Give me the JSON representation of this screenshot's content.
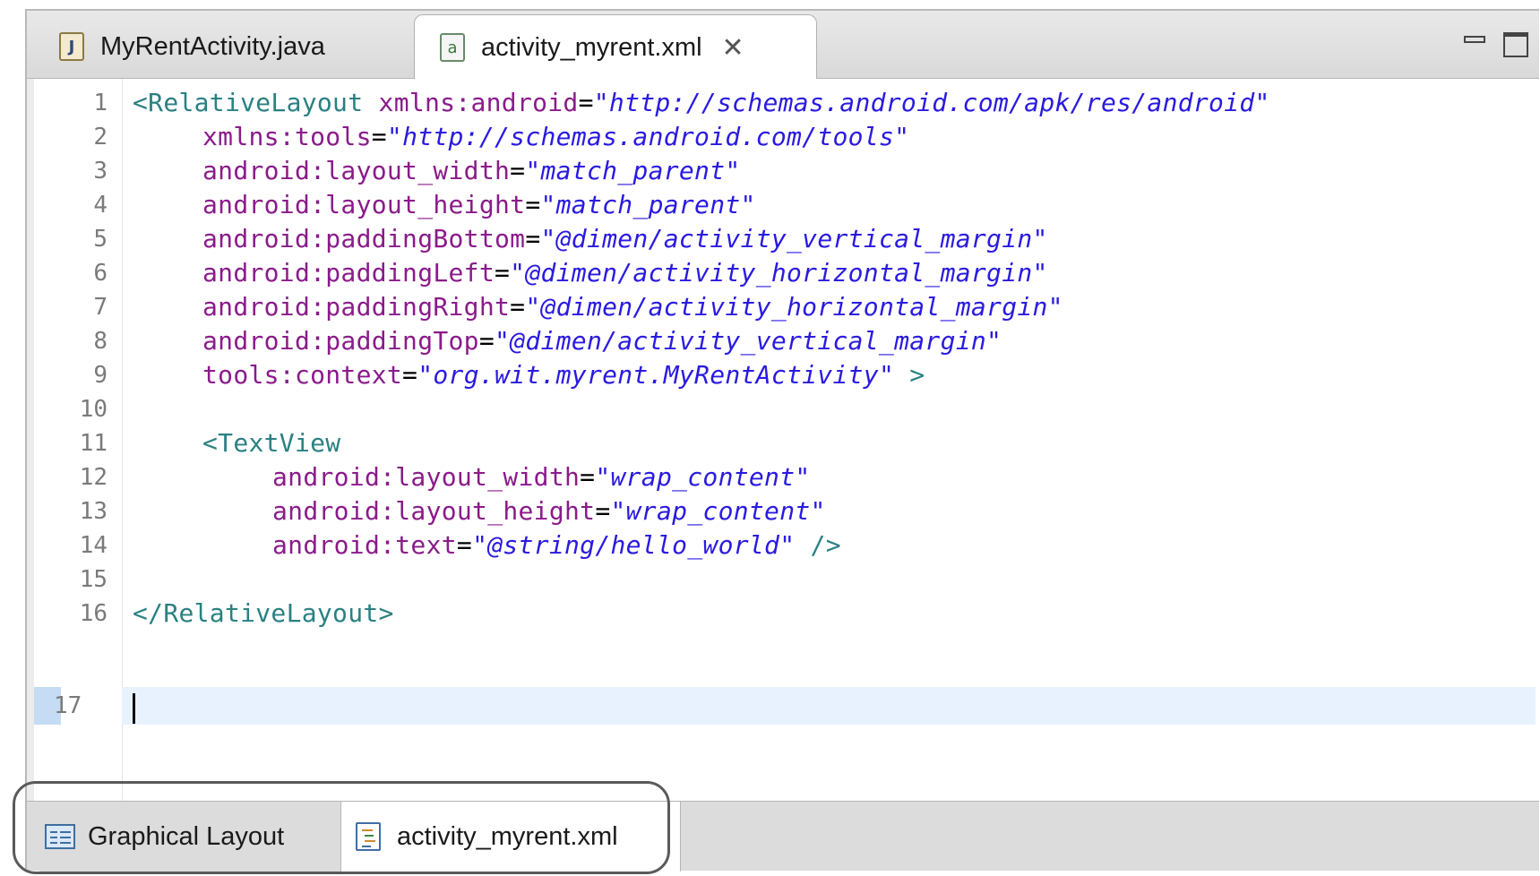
{
  "editor_tabs": [
    {
      "label": "MyRentActivity.java",
      "icon": "java-file-icon",
      "active": false
    },
    {
      "label": "activity_myrent.xml",
      "icon": "android-xml-file-icon",
      "active": true,
      "close_glyph": "✕"
    }
  ],
  "window_controls": {
    "minimize": "minimize-icon",
    "maximize": "maximize-icon"
  },
  "line_numbers": [
    "1",
    "2",
    "3",
    "4",
    "5",
    "6",
    "7",
    "8",
    "9",
    "10",
    "11",
    "12",
    "13",
    "14",
    "15",
    "16",
    "17"
  ],
  "code": {
    "l1": {
      "tag": "<RelativeLayout",
      "attr": "xmlns:android",
      "eq": "=",
      "val": "\"http://schemas.android.com/apk/res/android\""
    },
    "l2": {
      "attr": "xmlns:tools",
      "eq": "=",
      "val": "\"http://schemas.android.com/tools\""
    },
    "l3": {
      "attr": "android:layout_width",
      "eq": "=",
      "val": "\"match_parent\""
    },
    "l4": {
      "attr": "android:layout_height",
      "eq": "=",
      "val": "\"match_parent\""
    },
    "l5": {
      "attr": "android:paddingBottom",
      "eq": "=",
      "val": "\"@dimen/activity_vertical_margin\""
    },
    "l6": {
      "attr": "android:paddingLeft",
      "eq": "=",
      "val": "\"@dimen/activity_horizontal_margin\""
    },
    "l7": {
      "attr": "android:paddingRight",
      "eq": "=",
      "val": "\"@dimen/activity_horizontal_margin\""
    },
    "l8": {
      "attr": "android:paddingTop",
      "eq": "=",
      "val": "\"@dimen/activity_vertical_margin\""
    },
    "l9": {
      "attr": "tools:context",
      "eq": "=",
      "val": "\"org.wit.myrent.MyRentActivity\"",
      "tail": " >"
    },
    "l11": {
      "tag": "<TextView"
    },
    "l12": {
      "attr": "android:layout_width",
      "eq": "=",
      "val": "\"wrap_content\""
    },
    "l13": {
      "attr": "android:layout_height",
      "eq": "=",
      "val": "\"wrap_content\""
    },
    "l14": {
      "attr": "android:text",
      "eq": "=",
      "val": "\"@string/hello_world\"",
      "tail": " />"
    },
    "l16": {
      "tag": "</RelativeLayout>"
    }
  },
  "bottom_tabs": [
    {
      "label": "Graphical Layout",
      "icon": "graphical-layout-icon",
      "active": false
    },
    {
      "label": "activity_myrent.xml",
      "icon": "xml-source-icon",
      "active": true
    }
  ],
  "colors": {
    "tag": "#2a8082",
    "attribute": "#8a1b8a",
    "value": "#2a1ae0",
    "current_line": "#e8f2fe"
  }
}
